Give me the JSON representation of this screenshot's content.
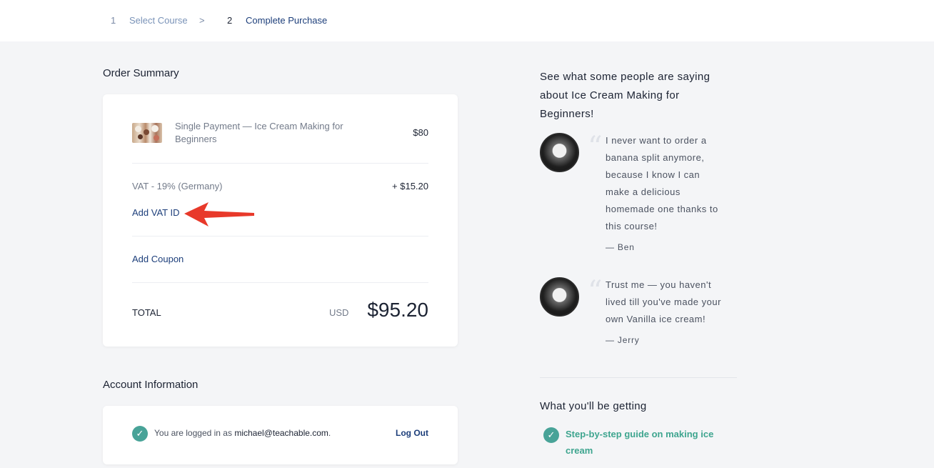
{
  "steps": [
    {
      "number": "1",
      "label": "Select Course"
    },
    {
      "separator": ">"
    },
    {
      "number": "2",
      "label": "Complete Purchase"
    }
  ],
  "order_summary": {
    "title": "Order Summary",
    "item": {
      "name": "Single Payment — Ice Cream Making for Beginners",
      "name_line1": "Single Payment — Ice Cream Making for",
      "name_line2": "Beginners",
      "price": "$80"
    },
    "vat": {
      "label": "VAT - 19% (Germany)",
      "amount": "+ $15.20",
      "add_vat_id": "Add VAT ID"
    },
    "coupon_link": "Add Coupon",
    "total": {
      "label": "TOTAL",
      "currency": "USD",
      "amount": "$95.20"
    }
  },
  "account": {
    "title": "Account Information",
    "logged_in_prefix": "You are logged in as",
    "email": "michael@teachable.com",
    "suffix": ".",
    "logout": "Log Out"
  },
  "testimonials": {
    "heading_lines": [
      "See what some people are saying",
      "about Ice Cream Making for",
      "Beginners!"
    ],
    "quotes": [
      {
        "lines": [
          "I never want to order a",
          "banana split anymore,",
          "because I know I can",
          "make a delicious",
          "homemade one thanks to",
          "this course!"
        ],
        "author": "— Ben"
      },
      {
        "lines": [
          "Trust me — you haven't",
          "lived till you've made your",
          "own Vanilla ice cream!"
        ],
        "author": "— Jerry"
      }
    ]
  },
  "getting": {
    "title": "What you'll be getting",
    "features": [
      {
        "lines": [
          "Step-by-step guide on making ice",
          "cream"
        ]
      }
    ]
  },
  "colors": {
    "accent": "#1c3e7a",
    "check": "#48a398",
    "arrow": "#e8392a",
    "feature": "#3ea58f"
  },
  "icons": {
    "quote": "quote-icon",
    "check": "check-icon",
    "annotation": "red-arrow-icon"
  }
}
